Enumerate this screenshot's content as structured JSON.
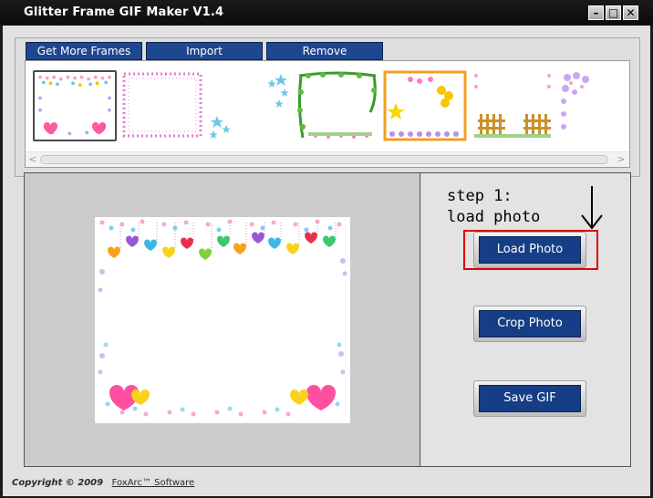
{
  "window": {
    "title": "Glitter Frame GIF Maker V1.4",
    "controls": {
      "minimize": "–",
      "maximize": "□",
      "close": "✕"
    }
  },
  "frames_panel": {
    "tabs": [
      "Get More Frames",
      "Import",
      "Remove"
    ],
    "thumbnails": [
      "frame-hearts-icon",
      "frame-pink-dots-icon",
      "frame-blue-stars-icon",
      "frame-green-vines-icon",
      "frame-balloons-icon",
      "frame-fence-icon",
      "frame-purple-icon"
    ],
    "selected_index": 0
  },
  "controls": {
    "hint": "step 1:\nload photo",
    "buttons": {
      "load": "Load Photo",
      "crop": "Crop Photo",
      "save": "Save GIF"
    }
  },
  "footer": {
    "copyright": "Copyright © 2009",
    "company": "FoxArc™ Software"
  },
  "colors": {
    "button_blue": "#163e86",
    "highlight": "#e00000",
    "titlebar": "#111111"
  }
}
